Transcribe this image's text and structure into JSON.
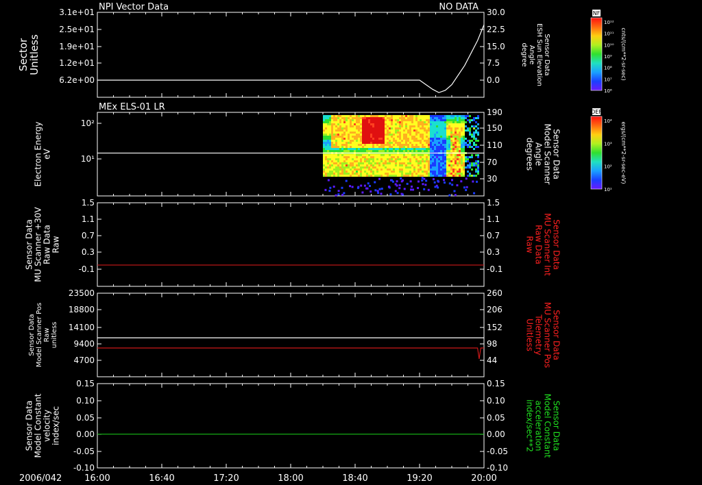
{
  "meta": {
    "date_label": "2006/042"
  },
  "time_axis": {
    "ticks": [
      "16:00",
      "16:40",
      "17:20",
      "18:00",
      "18:40",
      "19:20",
      "20:00"
    ],
    "range": [
      "16:00",
      "20:00"
    ]
  },
  "chart_data": [
    {
      "type": "line",
      "panel": "npi-vector",
      "title": "NPI Vector Data",
      "status": "NO DATA",
      "ylabel_left": [
        "Sector",
        "Unitless"
      ],
      "yticks_left": [
        "3.1e+01",
        "2.5e+01",
        "1.9e+01",
        "1.2e+01",
        "6.2e+00"
      ],
      "ylabel_right": [
        "Sensor Data",
        "ESH Sun Elevation",
        "Angle",
        "degree"
      ],
      "yticks_right": [
        "30.0",
        "22.5",
        "15.0",
        "7.5",
        "0.0"
      ],
      "ylim_right": [
        -4,
        30
      ],
      "series": [
        {
          "x": [
            "16:00",
            "19:20",
            "19:24",
            "19:28",
            "19:32",
            "19:36",
            "19:40",
            "19:48",
            "19:56",
            "20:00"
          ],
          "y": [
            0.0,
            0.0,
            -2.0,
            -4.0,
            -5.5,
            -4.5,
            -2.0,
            6.5,
            17.5,
            24.5
          ],
          "color": "#ffffff"
        }
      ],
      "colorbar": {
        "label": "NF",
        "units": "cnts/(cm**2-sr-sec)",
        "ticks": [
          "10¹²",
          "10¹¹",
          "10¹⁰",
          "10⁹",
          "10⁸",
          "10⁷",
          "10⁶"
        ]
      }
    },
    {
      "type": "heatmap",
      "panel": "mex-els",
      "title": "MEx ELS-01 LR",
      "ylabel_left": [
        "Electron Energy",
        "eV"
      ],
      "yticks_left": [
        "10²",
        "10¹"
      ],
      "ylabel_right": [
        "Sensor Data",
        "Model Scanner",
        "Angle",
        "degrees"
      ],
      "yticks_right": [
        "190",
        "150",
        "110",
        "70",
        "30"
      ],
      "ylim_right": [
        0,
        190
      ],
      "data_window": [
        "18:20",
        "20:00"
      ],
      "overlay_line": {
        "y_right": 92
      },
      "colorbar": {
        "label": "DEF",
        "units": "ergs/(cm**2-sr-sec-eV)",
        "ticks": [
          "10⁴",
          "10³",
          "10²",
          "10¹"
        ]
      }
    },
    {
      "type": "line",
      "panel": "mu-scanner",
      "ylabel_left": [
        "Sensor Data",
        "MU Scanner +30V",
        "Raw Data",
        "Raw"
      ],
      "yticks_left": [
        "1.5",
        "1.1",
        "0.7",
        "0.3",
        "-0.1"
      ],
      "ylabel_right": [
        "Sensor Data",
        "MU Scanner Int",
        "Raw Data",
        "Raw"
      ],
      "yticks_right": [
        "1.5",
        "1.1",
        "0.7",
        "0.3",
        "-0.1"
      ],
      "ylim": [
        -0.4,
        1.5
      ],
      "series": [
        {
          "x": [
            "16:00",
            "20:00"
          ],
          "y": [
            0.0,
            0.0
          ],
          "color": "#cc1818"
        }
      ]
    },
    {
      "type": "line",
      "panel": "scanner-pos",
      "ylabel_left": [
        "Sensor Data",
        "Model Scanner Pos",
        "Raw",
        "unitless"
      ],
      "yticks_left": [
        "23500",
        "18800",
        "14100",
        "9400",
        "4700"
      ],
      "ylim_left": [
        0,
        23500
      ],
      "ylabel_right": [
        "Sensor Data",
        "MU Scanner Pos",
        "Telemetry",
        "Unitless"
      ],
      "yticks_right": [
        "260",
        "206",
        "152",
        "98",
        "44"
      ],
      "ylim_right": [
        0,
        260
      ],
      "series": [
        {
          "x": [
            "16:00",
            "20:00"
          ],
          "y": [
            11000,
            11000
          ],
          "color": "#ffffff"
        },
        {
          "x": [
            "16:00",
            "19:56",
            "19:57",
            "19:58",
            "20:00"
          ],
          "y": [
            8150,
            8150,
            5100,
            8150,
            8150
          ],
          "color": "#cc1818"
        }
      ]
    },
    {
      "type": "line",
      "panel": "constant",
      "ylabel_left": [
        "Sensor Data",
        "Model Constant",
        "velocity",
        "index/sec"
      ],
      "yticks_left": [
        "0.15",
        "0.10",
        "0.05",
        "0.00",
        "-0.05",
        "-0.10"
      ],
      "ylim": [
        -0.1,
        0.15
      ],
      "ylabel_right": [
        "Sensor Data",
        "Model Constant",
        "acceleration",
        "index/sec**2"
      ],
      "yticks_right": [
        "0.15",
        "0.10",
        "0.05",
        "0.00",
        "-0.05",
        "-0.10"
      ],
      "series": [
        {
          "x": [
            "16:00",
            "20:00"
          ],
          "y": [
            0.0,
            0.0
          ],
          "color": "#18c018"
        }
      ]
    }
  ],
  "colors": {
    "red_label": "#ff2020",
    "green_label": "#20e020",
    "axis": "#ffffff"
  }
}
